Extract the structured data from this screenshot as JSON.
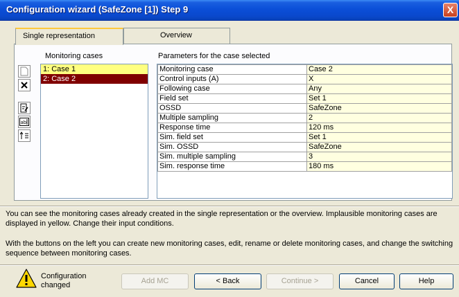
{
  "window": {
    "title": "Configuration wizard (SafeZone [1]) Step 9",
    "close_label": "X"
  },
  "tabs": [
    {
      "label": "Single representation"
    },
    {
      "label": "Overview"
    }
  ],
  "monitoring": {
    "header": "Monitoring cases",
    "cases": [
      {
        "label": "1:  Case 1"
      },
      {
        "label": "2:  Case 2"
      }
    ]
  },
  "params": {
    "header": "Parameters for the case selected",
    "rows": [
      {
        "name": "Monitoring case",
        "value": "Case 2"
      },
      {
        "name": "Control inputs (A)",
        "value": "X"
      },
      {
        "name": "Following case",
        "value": "Any"
      },
      {
        "name": "Field set",
        "value": "Set 1"
      },
      {
        "name": "OSSD",
        "value": "SafeZone"
      },
      {
        "name": "Multiple sampling",
        "value": "2"
      },
      {
        "name": "Response time",
        "value": "120 ms"
      },
      {
        "name": "Sim. field set",
        "value": "Set 1"
      },
      {
        "name": "Sim. OSSD",
        "value": "SafeZone"
      },
      {
        "name": "Sim. multiple sampling",
        "value": "3"
      },
      {
        "name": "Sim. response time",
        "value": "180 ms"
      }
    ]
  },
  "help": {
    "para1": "You can see the monitoring cases already created in the single representation or the overview. Implausible monitoring cases are displayed in yellow. Change their input conditions.",
    "para2": "With the buttons on the left you can create new monitoring cases, edit, rename or delete monitoring cases, and change the switching sequence between monitoring cases."
  },
  "status": {
    "line1": "Configuration",
    "line2": "changed",
    "icon": "warning-icon"
  },
  "buttons": {
    "add_mc": "Add MC",
    "back": "< Back",
    "continue": "Continue >",
    "cancel": "Cancel",
    "help": "Help"
  },
  "colors": {
    "case_implausible": "#ffff80",
    "case_selected": "#800000",
    "value_cell": "#ffffe0"
  }
}
